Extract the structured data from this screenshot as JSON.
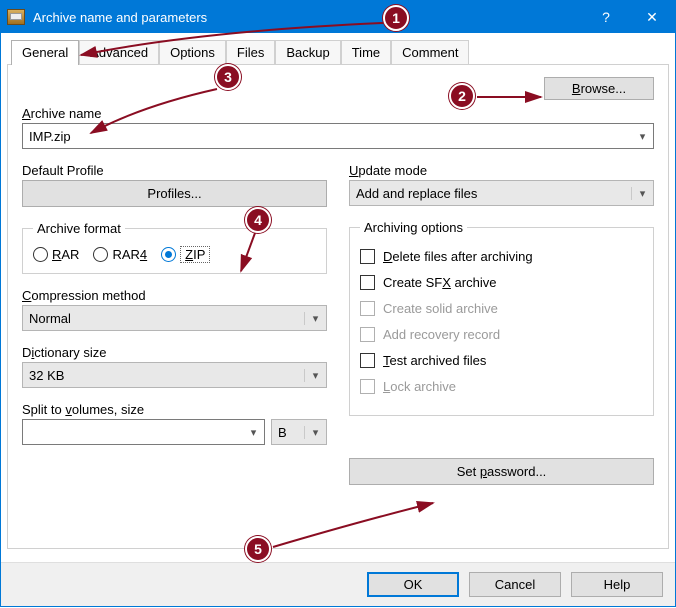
{
  "window": {
    "title": "Archive name and parameters"
  },
  "tabs": [
    "General",
    "Advanced",
    "Options",
    "Files",
    "Backup",
    "Time",
    "Comment"
  ],
  "archive_name": {
    "label": "Archive name",
    "value": "IMP.zip"
  },
  "browse_label": "Browse...",
  "default_profile": {
    "label": "Default Profile",
    "button": "Profiles..."
  },
  "archive_format": {
    "legend": "Archive format",
    "options": [
      "RAR",
      "RAR4",
      "ZIP"
    ],
    "selected": "ZIP"
  },
  "compression": {
    "label": "Compression method",
    "value": "Normal"
  },
  "dictionary": {
    "label": "Dictionary size",
    "value": "32 KB"
  },
  "split": {
    "label": "Split to volumes, size",
    "value": "",
    "unit": "B"
  },
  "update_mode": {
    "label": "Update mode",
    "value": "Add and replace files"
  },
  "archiving_options": {
    "legend": "Archiving options",
    "items": [
      {
        "label": "Delete files after archiving",
        "enabled": true
      },
      {
        "label": "Create SFX archive",
        "enabled": true
      },
      {
        "label": "Create solid archive",
        "enabled": false
      },
      {
        "label": "Add recovery record",
        "enabled": false
      },
      {
        "label": "Test archived files",
        "enabled": true
      },
      {
        "label": "Lock archive",
        "enabled": false
      }
    ]
  },
  "set_password_label": "Set password...",
  "footer": {
    "ok": "OK",
    "cancel": "Cancel",
    "help": "Help"
  },
  "annotations": {
    "1": "1",
    "2": "2",
    "3": "3",
    "4": "4",
    "5": "5"
  }
}
